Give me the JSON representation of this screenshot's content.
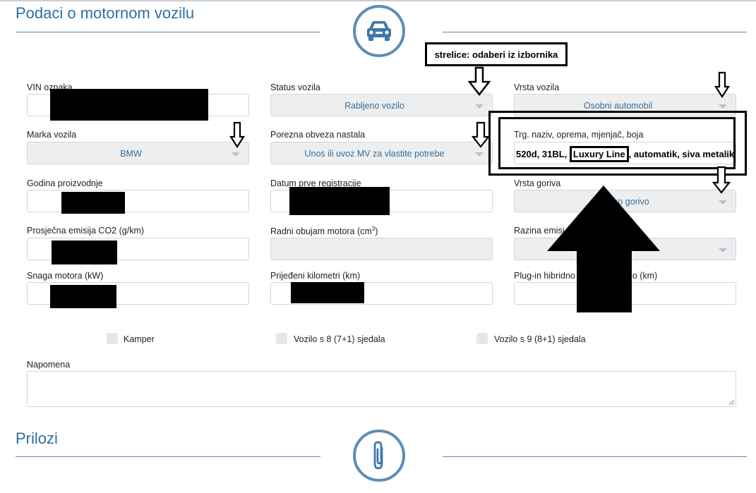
{
  "sections": {
    "vehicle_title": "Podaci o motornom vozilu",
    "attachments_title": "Prilozi"
  },
  "fields": {
    "vin_label": "VIN oznaka",
    "status_label": "Status vozila",
    "status_value": "Rabljeno vozilo",
    "vrsta_label": "Vrsta vozila",
    "vrsta_value": "Osobni automobil",
    "marka_label": "Marka vozila",
    "marka_value": "BMW",
    "porezna_label": "Porezna obveza nastala",
    "porezna_value": "Unos ili uvoz MV za vlastite potrebe",
    "trg_label": "Trg. naziv, oprema, mjenjač, boja",
    "trg_value_part1": "520d, 31BL,",
    "trg_value_highlight": "Luxury Line",
    "trg_value_part2": ", automatik, siva metalik",
    "godina_label": "Godina proizvodnje",
    "datum_label": "Datum prve registracije",
    "gorivo_label": "Vrsta goriva",
    "gorivo_value": "ko gorivo",
    "emisija_label": "Prosječna emisija CO2 (g/km)",
    "obujam_label": "Radni obujam motora (cm",
    "obujam_sup": "3",
    "obujam_close": ")",
    "razina_label": "Razina emisi",
    "snaga_label": "Snaga motora (kW)",
    "km_label": "Prijeđeni kilometri (km)",
    "plugin_label_a": "Plug-in hibridno",
    "plugin_label_b": "lo (km)",
    "napomena_label": "Napomena"
  },
  "checkboxes": {
    "kamper": "Kamper",
    "sjedala8": "Vozilo s 8 (7+1) sjedala",
    "sjedala9": "Vozilo s 9 (8+1) sjedala"
  },
  "annotation": {
    "arrows_note": "strelice: odaberi iz izbornika"
  },
  "icons": {
    "vehicle": "car-icon",
    "attachments": "paperclip-icon"
  },
  "colors": {
    "accent": "#2f6fa5",
    "circle": "#5b8db8",
    "value_text": "#3c6d96"
  }
}
